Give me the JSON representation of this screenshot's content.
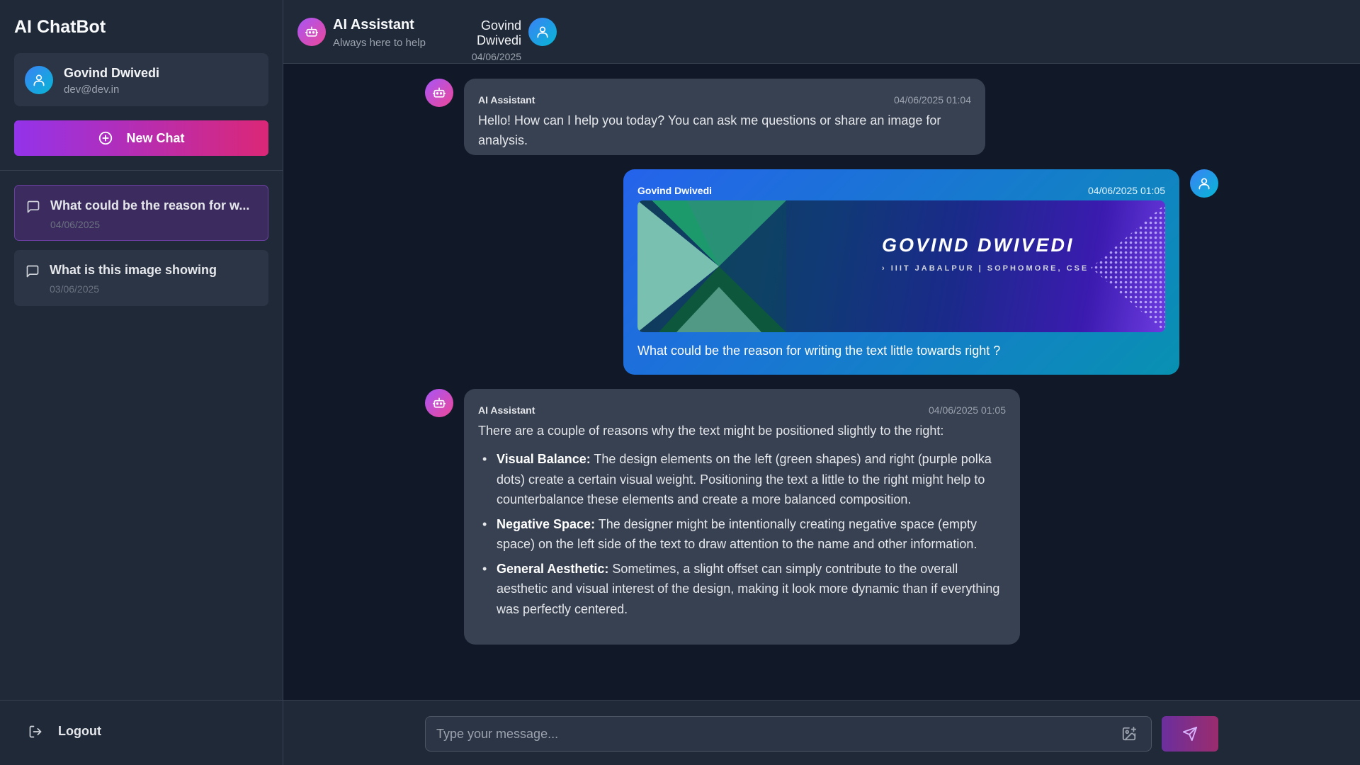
{
  "sidebar": {
    "brand": "AI ChatBot",
    "profile": {
      "name": "Govind Dwivedi",
      "email": "dev@dev.in"
    },
    "new_chat_label": "New Chat",
    "chats": [
      {
        "title": "What could be the reason for w...",
        "date": "04/06/2025",
        "active": true
      },
      {
        "title": "What is this image showing",
        "date": "03/06/2025",
        "active": false
      }
    ],
    "logout_label": "Logout"
  },
  "header": {
    "assistant_name": "AI Assistant",
    "assistant_sub": "Always here to help",
    "user_name": "Govind Dwivedi",
    "user_date": "04/06/2025"
  },
  "messages": [
    {
      "role": "assistant",
      "sender": "AI Assistant",
      "time": "04/06/2025 01:04",
      "text": "Hello! How can I help you today? You can ask me questions or share an image for analysis."
    },
    {
      "role": "user",
      "sender": "Govind Dwivedi",
      "time": "04/06/2025 01:05",
      "image": {
        "title": "GOVIND DWIVEDI",
        "subtitle": "› IIIT JABALPUR | SOPHOMORE, CSE"
      },
      "text": "What could be the reason for writing the text little towards right ?"
    },
    {
      "role": "assistant",
      "sender": "AI Assistant",
      "time": "04/06/2025 01:05",
      "intro": "There are a couple of reasons why the text might be positioned slightly to the right:",
      "points": [
        {
          "label": "Visual Balance:",
          "text": " The design elements on the left (green shapes) and right (purple polka dots) create a certain visual weight. Positioning the text a little to the right might help to counterbalance these elements and create a more balanced composition."
        },
        {
          "label": "Negative Space:",
          "text": " The designer might be intentionally creating negative space (empty space) on the left side of the text to draw attention to the name and other information."
        },
        {
          "label": "General Aesthetic:",
          "text": " Sometimes, a slight offset can simply contribute to the overall aesthetic and visual interest of the design, making it look more dynamic than if everything was perfectly centered."
        }
      ]
    }
  ],
  "composer": {
    "placeholder": "Type your message...",
    "value": ""
  },
  "icons": {
    "user_avatar": "user-icon",
    "bot_avatar": "bot-icon",
    "chat_item": "message-square-icon",
    "new_chat": "plus-circle-icon",
    "logout": "logout-icon",
    "image_upload": "image-plus-icon",
    "send": "send-icon"
  },
  "colors": {
    "accent_gradient_start": "#9333ea",
    "accent_gradient_end": "#db2777",
    "user_bubble_start": "#2563eb",
    "user_bubble_end": "#0891b2",
    "assistant_bubble": "#374151",
    "background": "#111827"
  }
}
